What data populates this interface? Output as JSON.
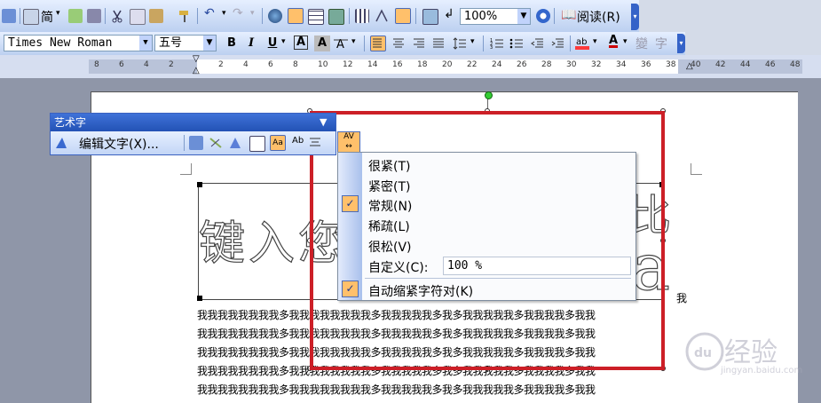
{
  "toolbar_standard": {
    "font_style_label": "简",
    "zoom_value": "100%",
    "read_label": "阅读(R)"
  },
  "toolbar_format": {
    "font_name": "Times New Roman",
    "font_size": "五号",
    "bold": "B",
    "italic": "I",
    "underline": "U",
    "char_border": "A",
    "char_shading": "A",
    "font_color_glyph": "A"
  },
  "ruler": {
    "numbers": [
      "8",
      "6",
      "4",
      "2",
      "2",
      "4",
      "6",
      "8",
      "10",
      "12",
      "14",
      "16",
      "18",
      "20",
      "22",
      "24",
      "26",
      "28",
      "30",
      "32",
      "34",
      "36",
      "38",
      "40",
      "42",
      "44",
      "46",
      "48"
    ]
  },
  "wordart_toolbar": {
    "title": "艺术字",
    "edit_text_label": "编辑文字(X)...",
    "tracking_glyph": "AV"
  },
  "wordart": {
    "text": "键入您",
    "right_glyph_top": "比",
    "right_glyph_bottom": "a"
  },
  "tracking_menu": {
    "items": [
      {
        "label": "很紧(T)",
        "checked": false
      },
      {
        "label": "紧密(T)",
        "checked": false
      },
      {
        "label": "常规(N)",
        "checked": true
      },
      {
        "label": "稀疏(L)",
        "checked": false
      },
      {
        "label": "很松(V)",
        "checked": false
      }
    ],
    "custom_label": "自定义(C):",
    "custom_value": "100 %",
    "kern_label": "自动缩紧字符对(K)",
    "kern_checked": true
  },
  "document": {
    "first_line_tail": "我",
    "lines": [
      "我我我我我我我我多我我我我我我我我多我我我我我多我多我我我我我多我我我我多我我",
      "我我我我我我我我多我我我我我我我我多我我我我我多我多我我我我我多我我我我多我我",
      "我我我我我我我我多我我我我我我我我多我我我我我多我多我我我我我多我我我我多我我",
      "我我我我我我我我多我我我我我我我我多我我我我我多我多我我我我我多我我我我多我我",
      "我我我我我我我我多我我我我我我我我多我我我我我多我多我我我我我多我我我我多我我"
    ]
  },
  "watermark": {
    "brand": "经验",
    "domain": "jingyan.baidu.com"
  },
  "colors": {
    "highlight_red": "#cc1f27",
    "menu_check_bg": "#ffc06b",
    "toolbar_title_blue": "#2352b5"
  }
}
